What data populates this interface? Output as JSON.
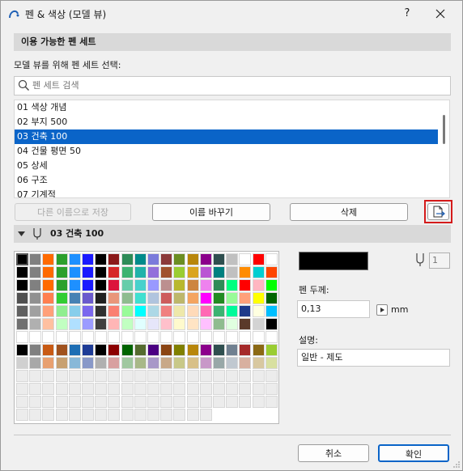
{
  "window": {
    "title": "펜 & 색상 (모델 뷰)",
    "help_label": "?"
  },
  "pen_sets": {
    "section_title": "이용 가능한 펜 세트",
    "select_label": "모델 뷰를 위해 펜 세트 선택:",
    "search_placeholder": "펜 세트 검색",
    "items": [
      {
        "label": "01 색상 개념"
      },
      {
        "label": "02 부지 500"
      },
      {
        "label": "03 건축 100"
      },
      {
        "label": "04 건물 평면 50"
      },
      {
        "label": "05 상세"
      },
      {
        "label": "06 구조"
      },
      {
        "label": "07 기계적"
      }
    ],
    "selected_index": 2,
    "buttons": {
      "save_as": "다른 이름으로 저장",
      "rename": "이름 바꾸기",
      "delete": "삭제"
    }
  },
  "pen_table": {
    "header_title": "03 건축 100",
    "pen_number": "1",
    "selected_color": "#000000",
    "pen_weight_label": "펜 두께:",
    "pen_weight_value": "0,13",
    "pen_weight_unit": "mm",
    "description_label": "설명:",
    "description_value": "일반 - 제도",
    "palette": [
      [
        "#000000",
        "#808080",
        "#ff6a00",
        "#2ca02c",
        "#1e90ff",
        "#1a1aff",
        "#000000",
        "#8b1a1a",
        "#2e8b57",
        "#008b8b",
        "#7b7bdb",
        "#8b3a3a",
        "#6b8e23",
        "#b8860b",
        "#8b008b",
        "#2f4f4f",
        "#c0c0c0",
        "#ffffff",
        "#ff0000",
        "#ffffff"
      ],
      [
        "#000000",
        "#808080",
        "#ff6a00",
        "#2ca02c",
        "#1e90ff",
        "#1a1aff",
        "#000000",
        "#d62728",
        "#3cb371",
        "#20b2aa",
        "#9370db",
        "#a0522d",
        "#9acd32",
        "#daa520",
        "#ba55d3",
        "#008080",
        "#c0c0c0",
        "#ff8c00",
        "#00ced1",
        "#ff4500"
      ],
      [
        "#000000",
        "#808080",
        "#ff6a00",
        "#2ca02c",
        "#1e90ff",
        "#1a1aff",
        "#000000",
        "#dc143c",
        "#66cdaa",
        "#48d1cc",
        "#9999ff",
        "#bc8f8f",
        "#b8b82e",
        "#cd853f",
        "#ee82ee",
        "#2e8b57",
        "#00ff7f",
        "#ff0000",
        "#ffb6c1",
        "#00ff00"
      ],
      [
        "#505050",
        "#909090",
        "#ff7f50",
        "#32cd32",
        "#4682b4",
        "#6a5acd",
        "#202020",
        "#e9967a",
        "#8fbc8f",
        "#40e0d0",
        "#b0c4de",
        "#cd5c5c",
        "#bdb76b",
        "#f4a460",
        "#ff00ff",
        "#228b22",
        "#98fb98",
        "#ffa07a",
        "#ffff00",
        "#006400"
      ],
      [
        "#606060",
        "#a0a0a0",
        "#ffa07a",
        "#90ee90",
        "#87ceeb",
        "#7b68ee",
        "#303030",
        "#fa8072",
        "#98fb98",
        "#00ffff",
        "#add8e6",
        "#f08080",
        "#eee8aa",
        "#ffdab9",
        "#ff69b4",
        "#3cb371",
        "#00fa9a",
        "#1e3a8a",
        "#ffffe0",
        "#00bfff"
      ],
      [
        "#707070",
        "#b0b0b0",
        "#ffc0a0",
        "#c1ffc1",
        "#b0e0ff",
        "#9b9bff",
        "#404040",
        "#ffb6b6",
        "#c1ffc1",
        "#e0ffff",
        "#e6e6fa",
        "#ffc0cb",
        "#fffacd",
        "#ffe4c4",
        "#ffc0ff",
        "#8fbc8f",
        "#e0ffe0",
        "#5a3a2a",
        "#d3d3d3",
        "#000000"
      ],
      [
        "#ffffff",
        "#ffffff",
        "#ffffff",
        "#ffffff",
        "#ffffff",
        "#ffffff",
        "#ffffff",
        "#ffffff",
        "#ffffff",
        "#ffffff",
        "#ffffff",
        "#ffffff",
        "#ffffff",
        "#ffffff",
        "#ffffff",
        "#ffffff",
        "#ffffff",
        "#ffffff",
        "#ffffff",
        "#ffffff"
      ],
      [
        "#000000",
        "#808080",
        "#c85a14",
        "#a0521e",
        "#1e6eb4",
        "#1e3c96",
        "#000000",
        "#8b0000",
        "#006400",
        "#556b2f",
        "#4b0082",
        "#8b4513",
        "#808000",
        "#b8860b",
        "#8b008b",
        "#2f4f4f",
        "#708090",
        "#a52a2a",
        "#8b6914",
        "#9acd32"
      ],
      [
        "#d0d0d0",
        "#a8a8a8",
        "#e8a070",
        "#c8a070",
        "#88b8d8",
        "#8898c8",
        "#b0b0b0",
        "#d8a0a0",
        "#a0c8a0",
        "#a8b888",
        "#a898c8",
        "#c8a888",
        "#c8c888",
        "#d8c088",
        "#c898c8",
        "#98a8a8",
        "#c0c8d0",
        "#d8b0a0",
        "#d8c8a0",
        "#d8e0a0"
      ]
    ]
  },
  "footer": {
    "cancel": "취소",
    "ok": "확인"
  }
}
